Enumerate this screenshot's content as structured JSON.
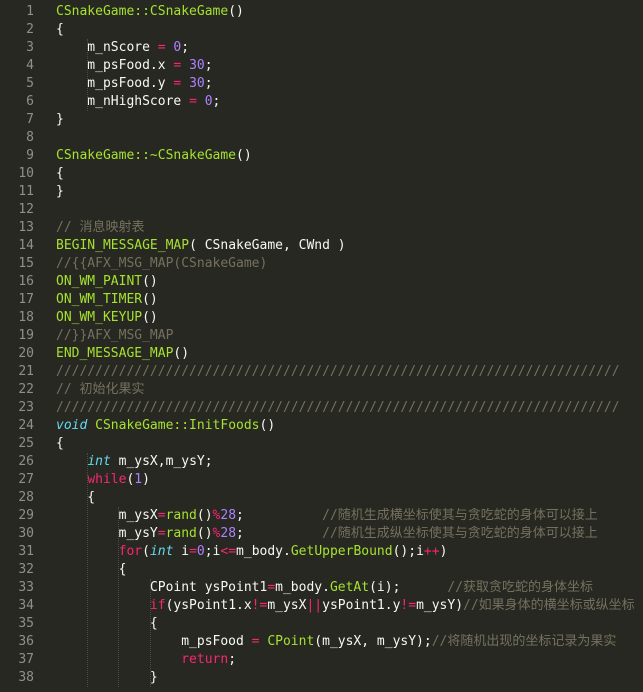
{
  "editor": {
    "theme": "monokai",
    "colors": {
      "background": "#272822",
      "text": "#f8f8f2",
      "function": "#a6e22e",
      "number": "#ae81ff",
      "operator": "#f92672",
      "comment": "#75715e",
      "type": "#66d9ef",
      "line_number": "#90908a"
    },
    "lines": [
      {
        "n": "1",
        "tokens": [
          [
            "fn",
            "CSnakeGame::CSnakeGame"
          ],
          [
            "pl",
            "()"
          ]
        ]
      },
      {
        "n": "2",
        "tokens": [
          [
            "pl",
            "{"
          ]
        ]
      },
      {
        "n": "3",
        "tokens": [
          [
            "pl",
            "    m_nScore "
          ],
          [
            "op",
            "="
          ],
          [
            "pl",
            " "
          ],
          [
            "num",
            "0"
          ],
          [
            "pl",
            ";"
          ]
        ]
      },
      {
        "n": "4",
        "tokens": [
          [
            "pl",
            "    m_psFood.x "
          ],
          [
            "op",
            "="
          ],
          [
            "pl",
            " "
          ],
          [
            "num",
            "30"
          ],
          [
            "pl",
            ";"
          ]
        ]
      },
      {
        "n": "5",
        "tokens": [
          [
            "pl",
            "    m_psFood.y "
          ],
          [
            "op",
            "="
          ],
          [
            "pl",
            " "
          ],
          [
            "num",
            "30"
          ],
          [
            "pl",
            ";"
          ]
        ]
      },
      {
        "n": "6",
        "tokens": [
          [
            "pl",
            "    m_nHighScore "
          ],
          [
            "op",
            "="
          ],
          [
            "pl",
            " "
          ],
          [
            "num",
            "0"
          ],
          [
            "pl",
            ";"
          ]
        ]
      },
      {
        "n": "7",
        "tokens": [
          [
            "pl",
            "}"
          ]
        ]
      },
      {
        "n": "8",
        "tokens": []
      },
      {
        "n": "9",
        "tokens": [
          [
            "fn",
            "CSnakeGame::~CSnakeGame"
          ],
          [
            "pl",
            "()"
          ]
        ]
      },
      {
        "n": "10",
        "tokens": [
          [
            "pl",
            "{"
          ]
        ]
      },
      {
        "n": "11",
        "tokens": [
          [
            "pl",
            "}"
          ]
        ]
      },
      {
        "n": "12",
        "tokens": []
      },
      {
        "n": "13",
        "tokens": [
          [
            "cm",
            "// 消息映射表"
          ]
        ]
      },
      {
        "n": "14",
        "tokens": [
          [
            "fn",
            "BEGIN_MESSAGE_MAP"
          ],
          [
            "pl",
            "( CSnakeGame, CWnd )"
          ]
        ]
      },
      {
        "n": "15",
        "tokens": [
          [
            "cm",
            "//{{AFX_MSG_MAP(CSnakeGame)"
          ]
        ]
      },
      {
        "n": "16",
        "tokens": [
          [
            "fn",
            "ON_WM_PAINT"
          ],
          [
            "pl",
            "()"
          ]
        ]
      },
      {
        "n": "17",
        "tokens": [
          [
            "fn",
            "ON_WM_TIMER"
          ],
          [
            "pl",
            "()"
          ]
        ]
      },
      {
        "n": "18",
        "tokens": [
          [
            "fn",
            "ON_WM_KEYUP"
          ],
          [
            "pl",
            "()"
          ]
        ]
      },
      {
        "n": "19",
        "tokens": [
          [
            "cm",
            "//}}AFX_MSG_MAP"
          ]
        ]
      },
      {
        "n": "20",
        "tokens": [
          [
            "fn",
            "END_MESSAGE_MAP"
          ],
          [
            "pl",
            "()"
          ]
        ]
      },
      {
        "n": "21",
        "tokens": [
          [
            "cm",
            "////////////////////////////////////////////////////////////////////////"
          ]
        ]
      },
      {
        "n": "22",
        "tokens": [
          [
            "cm",
            "// 初始化果实"
          ]
        ]
      },
      {
        "n": "23",
        "tokens": [
          [
            "cm",
            "////////////////////////////////////////////////////////////////////////"
          ]
        ]
      },
      {
        "n": "24",
        "tokens": [
          [
            "ty",
            "void"
          ],
          [
            "pl",
            " "
          ],
          [
            "fn",
            "CSnakeGame::InitFoods"
          ],
          [
            "pl",
            "()"
          ]
        ]
      },
      {
        "n": "25",
        "tokens": [
          [
            "pl",
            "{"
          ]
        ]
      },
      {
        "n": "26",
        "tokens": [
          [
            "pl",
            "    "
          ],
          [
            "ty",
            "int"
          ],
          [
            "pl",
            " m_ysX,m_ysY;"
          ]
        ]
      },
      {
        "n": "27",
        "tokens": [
          [
            "pl",
            "    "
          ],
          [
            "kw",
            "while"
          ],
          [
            "pl",
            "("
          ],
          [
            "num",
            "1"
          ],
          [
            "pl",
            ")"
          ]
        ]
      },
      {
        "n": "28",
        "tokens": [
          [
            "pl",
            "    {"
          ]
        ]
      },
      {
        "n": "29",
        "tokens": [
          [
            "pl",
            "        m_ysX"
          ],
          [
            "op",
            "="
          ],
          [
            "fn",
            "rand"
          ],
          [
            "pl",
            "()"
          ],
          [
            "op",
            "%"
          ],
          [
            "num",
            "28"
          ],
          [
            "pl",
            ";          "
          ],
          [
            "cm",
            "//随机生成横坐标使其与贪吃蛇的身体可以接上"
          ]
        ]
      },
      {
        "n": "30",
        "tokens": [
          [
            "pl",
            "        m_ysY"
          ],
          [
            "op",
            "="
          ],
          [
            "fn",
            "rand"
          ],
          [
            "pl",
            "()"
          ],
          [
            "op",
            "%"
          ],
          [
            "num",
            "28"
          ],
          [
            "pl",
            ";          "
          ],
          [
            "cm",
            "//随机生成纵坐标使其与贪吃蛇的身体可以接上"
          ]
        ]
      },
      {
        "n": "31",
        "tokens": [
          [
            "pl",
            "        "
          ],
          [
            "kw",
            "for"
          ],
          [
            "pl",
            "("
          ],
          [
            "ty",
            "int"
          ],
          [
            "pl",
            " i"
          ],
          [
            "op",
            "="
          ],
          [
            "num",
            "0"
          ],
          [
            "pl",
            ";i"
          ],
          [
            "op",
            "<="
          ],
          [
            "pl",
            "m_body."
          ],
          [
            "fn",
            "GetUpperBound"
          ],
          [
            "pl",
            "();i"
          ],
          [
            "op",
            "++"
          ],
          [
            "pl",
            ")"
          ]
        ]
      },
      {
        "n": "32",
        "tokens": [
          [
            "pl",
            "        {"
          ]
        ]
      },
      {
        "n": "33",
        "tokens": [
          [
            "pl",
            "            CPoint ysPoint1"
          ],
          [
            "op",
            "="
          ],
          [
            "pl",
            "m_body."
          ],
          [
            "fn",
            "GetAt"
          ],
          [
            "pl",
            "(i);      "
          ],
          [
            "cm",
            "//获取贪吃蛇的身体坐标"
          ]
        ]
      },
      {
        "n": "34",
        "tokens": [
          [
            "pl",
            "            "
          ],
          [
            "kw",
            "if"
          ],
          [
            "pl",
            "(ysPoint1.x"
          ],
          [
            "op",
            "!="
          ],
          [
            "pl",
            "m_ysX"
          ],
          [
            "op",
            "||"
          ],
          [
            "pl",
            "ysPoint1.y"
          ],
          [
            "op",
            "!="
          ],
          [
            "pl",
            "m_ysY)"
          ],
          [
            "cm",
            "//如果身体的横坐标或纵坐标"
          ]
        ]
      },
      {
        "n": "35",
        "tokens": [
          [
            "pl",
            "            {"
          ]
        ]
      },
      {
        "n": "36",
        "tokens": [
          [
            "pl",
            "                m_psFood "
          ],
          [
            "op",
            "="
          ],
          [
            "pl",
            " "
          ],
          [
            "fn",
            "CPoint"
          ],
          [
            "pl",
            "(m_ysX, m_ysY);"
          ],
          [
            "cm",
            "//将随机出现的坐标记录为果实"
          ]
        ]
      },
      {
        "n": "37",
        "tokens": [
          [
            "pl",
            "                "
          ],
          [
            "kw",
            "return"
          ],
          [
            "pl",
            ";"
          ]
        ]
      },
      {
        "n": "38",
        "tokens": [
          [
            "pl",
            "            }"
          ]
        ]
      }
    ],
    "guides": [
      {
        "col": 4,
        "from": 3,
        "to": 6
      },
      {
        "col": 4,
        "from": 26,
        "to": 38
      },
      {
        "col": 8,
        "from": 29,
        "to": 38
      },
      {
        "col": 12,
        "from": 33,
        "to": 38
      }
    ]
  }
}
